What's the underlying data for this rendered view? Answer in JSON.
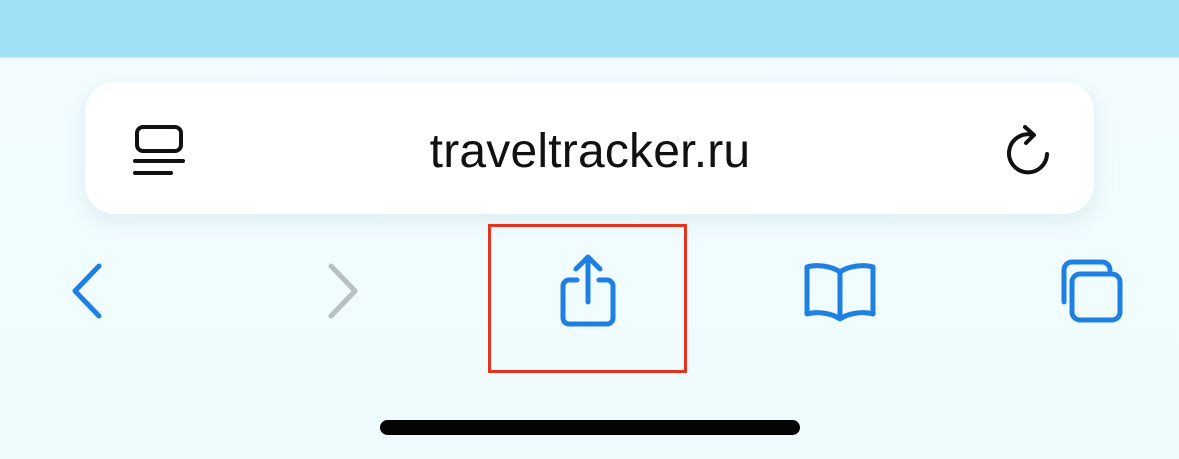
{
  "address_bar": {
    "url": "traveltracker.ru",
    "reader_icon": "reader-mode-icon",
    "reload_icon": "reload-icon"
  },
  "toolbar": {
    "back_icon": "chevron-left-icon",
    "forward_icon": "chevron-right-icon",
    "share_icon": "share-icon",
    "bookmarks_icon": "book-icon",
    "tabs_icon": "tabs-icon",
    "forward_enabled": false
  },
  "colors": {
    "accent": "#1f7fe3",
    "disabled": "#b8c0c4",
    "highlight": "#e5331e",
    "top_strip": "#9ee1f6",
    "background": "#f0fbfd"
  }
}
